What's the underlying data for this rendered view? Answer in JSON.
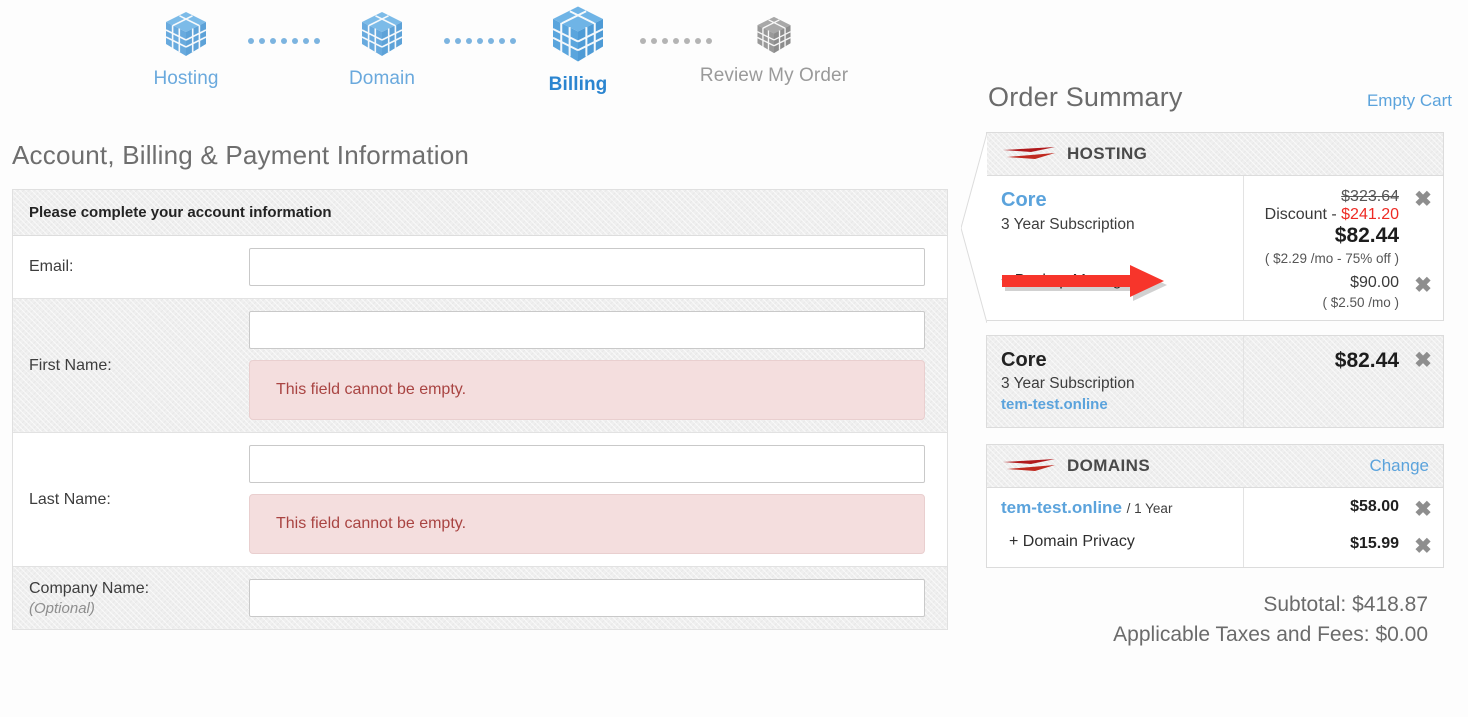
{
  "stepper": {
    "steps": [
      {
        "label": "Hosting",
        "state": "done",
        "icon": "cube-icon"
      },
      {
        "label": "Domain",
        "state": "done",
        "icon": "cube-icon"
      },
      {
        "label": "Billing",
        "state": "current",
        "icon": "cube-icon"
      },
      {
        "label": "Review My Order",
        "state": "inactive",
        "icon": "cube-icon"
      }
    ]
  },
  "form": {
    "title": "Account, Billing & Payment Information",
    "panel_header": "Please complete your account information",
    "error_text": "This field cannot be empty.",
    "fields": {
      "email": {
        "label": "Email:",
        "value": ""
      },
      "first_name": {
        "label": "First Name:",
        "value": "",
        "error": "This field cannot be empty."
      },
      "last_name": {
        "label": "Last Name:",
        "value": "",
        "error": "This field cannot be empty."
      },
      "company": {
        "label": "Company Name:",
        "optional": "(Optional)",
        "value": ""
      }
    }
  },
  "summary": {
    "title": "Order Summary",
    "empty_cart_label": "Empty Cart",
    "hosting": {
      "header": "HOSTING",
      "product": {
        "name": "Core",
        "term": "3 Year Subscription",
        "original_price": "$323.64",
        "discount_label": "Discount -",
        "discount_amount": "$241.20",
        "final_price": "$82.44",
        "rate_note": "( $2.29 /mo - 75% off )"
      },
      "addon": {
        "label": "+ Backup Manager",
        "price": "$90.00",
        "rate_note": "( $2.50 /mo )"
      }
    },
    "hosting_summary": {
      "name": "Core",
      "term": "3 Year Subscription",
      "domain": "tem-test.online",
      "price": "$82.44"
    },
    "domains": {
      "header": "DOMAINS",
      "change_label": "Change",
      "domain_name": "tem-test.online",
      "domain_term": "/ 1 Year",
      "domain_price": "$58.00",
      "privacy_label": "+ Domain Privacy",
      "privacy_price": "$15.99"
    },
    "totals": {
      "subtotal": "Subtotal: $418.87",
      "taxes": "Applicable Taxes and Fees: $0.00"
    }
  },
  "colors": {
    "link_blue": "#5ba3dc",
    "active_blue": "#2b85d0",
    "discount_red": "#ee2a24",
    "brand_red": "#b0191c",
    "error_text": "#a94442",
    "error_bg": "#f4dede",
    "annotation_arrow": "#f7352b"
  }
}
